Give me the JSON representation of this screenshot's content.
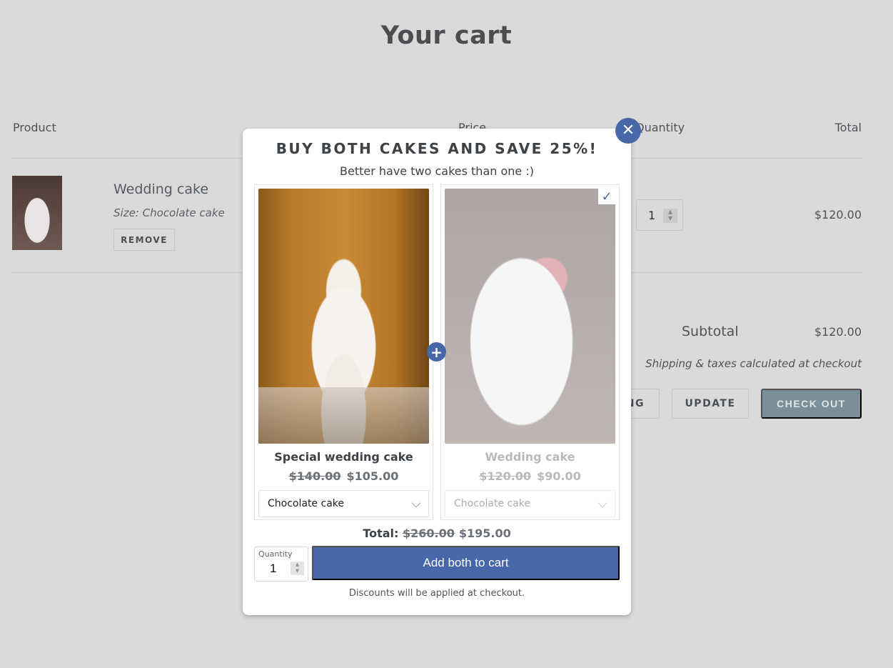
{
  "page": {
    "title": "Your cart",
    "columns": [
      "Product",
      "Price",
      "Quantity",
      "Total"
    ]
  },
  "cart": {
    "items": [
      {
        "title": "Wedding cake",
        "variant": "Size: Chocolate cake",
        "remove_label": "REMOVE",
        "quantity": "1",
        "line_total": "$120.00",
        "image": "wedding-cake-thumbnail"
      }
    ],
    "subtotal_label": "Subtotal",
    "subtotal_value": "$120.00",
    "shipping_note": "Shipping & taxes calculated at checkout",
    "continue_label_visible": "NG",
    "update_label": "UPDATE",
    "checkout_label": "CHECK OUT"
  },
  "modal": {
    "close_icon": "close-icon",
    "title": "BUY BOTH CAKES AND SAVE 25%!",
    "subtitle": "Better have two cakes than one :)",
    "plus_icon": "plus-icon",
    "products": [
      {
        "name": "Special wedding cake",
        "old_price": "$140.00",
        "new_price": "$105.00",
        "option": "Chocolate cake",
        "image": "special-wedding-cake-photo",
        "selected": false
      },
      {
        "name": "Wedding cake",
        "old_price": "$120.00",
        "new_price": "$90.00",
        "option": "Chocolate cake",
        "image": "wedding-cake-photo",
        "selected": true,
        "check_icon": "✓"
      }
    ],
    "total_label": "Total:",
    "total_old": "$260.00",
    "total_new": "$195.00",
    "quantity_label": "Quantity",
    "quantity_value": "1",
    "add_button_label": "Add both to cart",
    "discount_note": "Discounts will be applied at checkout."
  },
  "colors": {
    "accent": "#4767a8",
    "checkout_button": "#7a8f99",
    "backdrop": "#dadada"
  }
}
